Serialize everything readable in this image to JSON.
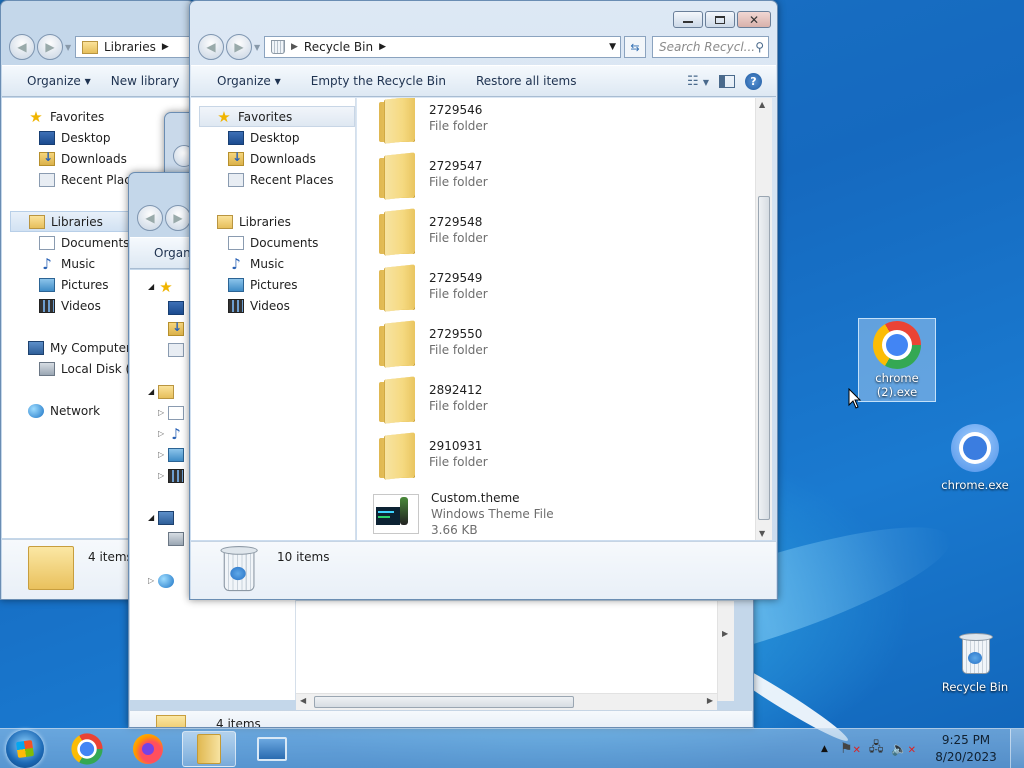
{
  "desktop": {
    "icons": [
      {
        "label": "chrome (2).exe",
        "icon": "chrome-icon",
        "selected": true
      },
      {
        "label": "chrome.exe",
        "icon": "chromium-icon",
        "selected": false
      },
      {
        "label": "Recycle Bin",
        "icon": "recycle-bin-icon",
        "selected": false
      }
    ]
  },
  "win_libraries": {
    "address": "Libraries",
    "toolbar": {
      "organize": "Organize",
      "new_library": "New library"
    },
    "nav": {
      "favorites": "Favorites",
      "desktop": "Desktop",
      "downloads": "Downloads",
      "recent": "Recent Places",
      "libraries": "Libraries",
      "documents": "Documents",
      "music": "Music",
      "pictures": "Pictures",
      "videos": "Videos",
      "computer": "My Computer",
      "local_disk": "Local Disk (C:)",
      "network": "Network"
    },
    "status": "4 items"
  },
  "win_middle": {
    "toolbar_organize": "Organize",
    "status": "4 items"
  },
  "win_recycle": {
    "address": "Recycle Bin",
    "search_placeholder": "Search Recycl...",
    "toolbar": {
      "organize": "Organize",
      "empty": "Empty the Recycle Bin",
      "restore": "Restore all items"
    },
    "nav": {
      "favorites": "Favorites",
      "desktop": "Desktop",
      "downloads": "Downloads",
      "recent": "Recent Places",
      "libraries": "Libraries",
      "documents": "Documents",
      "music": "Music",
      "pictures": "Pictures",
      "videos": "Videos"
    },
    "items": [
      {
        "name": "2729546",
        "type": "File folder"
      },
      {
        "name": "2729547",
        "type": "File folder"
      },
      {
        "name": "2729548",
        "type": "File folder"
      },
      {
        "name": "2729549",
        "type": "File folder"
      },
      {
        "name": "2729550",
        "type": "File folder"
      },
      {
        "name": "2892412",
        "type": "File folder"
      },
      {
        "name": "2910931",
        "type": "File folder"
      },
      {
        "name": "Custom.theme",
        "type": "Windows Theme File",
        "size": "3.66 KB"
      }
    ],
    "status": "10 items"
  },
  "taskbar": {
    "items": [
      "chrome-icon",
      "firefox-icon",
      "explorer-icon",
      "remote-desktop-icon"
    ],
    "clock_time": "9:25 PM",
    "clock_date": "8/20/2023"
  }
}
